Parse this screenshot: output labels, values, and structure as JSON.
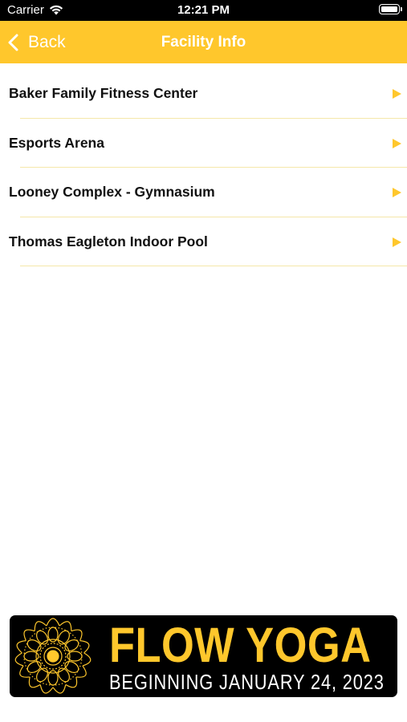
{
  "status_bar": {
    "carrier": "Carrier",
    "time": "12:21 PM"
  },
  "nav": {
    "back_label": "Back",
    "title": "Facility Info"
  },
  "facilities": [
    {
      "label": "Baker Family Fitness Center"
    },
    {
      "label": "Esports Arena"
    },
    {
      "label": "Looney Complex - Gymnasium"
    },
    {
      "label": "Thomas Eagleton Indoor Pool"
    }
  ],
  "banner": {
    "title": "FLOW YOGA",
    "subtitle": "BEGINNING JANUARY 24, 2023"
  },
  "colors": {
    "accent": "#FFC72C",
    "divider": "#F5E7A9",
    "status_bar": "#000000"
  }
}
